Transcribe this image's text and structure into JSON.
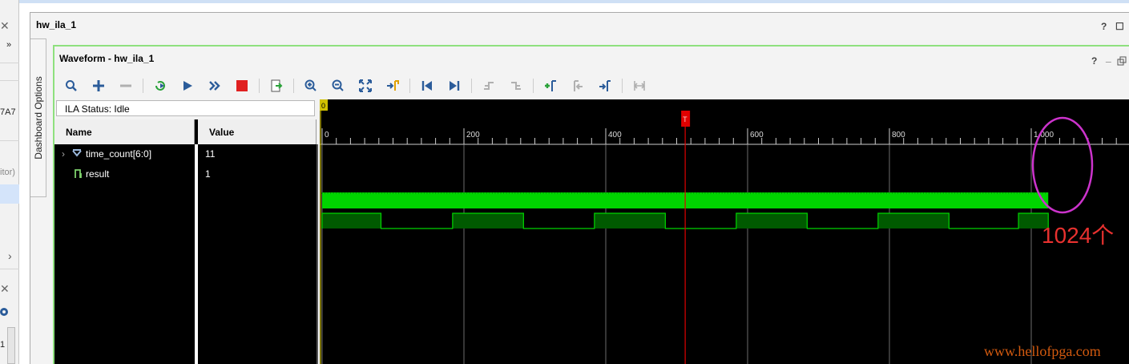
{
  "left_panel": {
    "close_glyph": "✕",
    "chevron": "»",
    "fragment_1": "7A7",
    "fragment_2": "itor)",
    "fragment_3": "1",
    "scroll_right": "›"
  },
  "window": {
    "title": "hw_ila_1",
    "help": "?",
    "restore": "☐"
  },
  "dashboard_tab": {
    "label": "Dashboard Options"
  },
  "waveform_panel": {
    "title": "Waveform - hw_ila_1",
    "help": "?",
    "minimize": "_"
  },
  "toolbar": {
    "icons": [
      "search-icon",
      "add-icon",
      "remove-icon",
      "rerun-icon",
      "run-icon",
      "run-all-icon",
      "stop-icon",
      "export-icon",
      "zoom-in-icon",
      "zoom-out-icon",
      "zoom-fit-icon",
      "go-to-cursor-icon",
      "go-to-start-icon",
      "go-to-end-icon",
      "prev-transition-icon",
      "next-transition-icon",
      "add-marker-icon",
      "prev-marker-icon",
      "next-marker-icon",
      "swap-cursors-icon"
    ]
  },
  "ila": {
    "status": "ILA Status:  Idle"
  },
  "table": {
    "columns": [
      "Name",
      "Value"
    ],
    "rows": [
      {
        "name": "time_count[6:0]",
        "value": "11",
        "icon": "bus-icon",
        "expandable": true
      },
      {
        "name": "result",
        "value": "1",
        "icon": "signal-icon",
        "expandable": false
      }
    ]
  },
  "timeline": {
    "start_marker": "0",
    "trigger_marker": "T",
    "ticks": [
      "0",
      "200",
      "400",
      "600",
      "800",
      "1,000"
    ],
    "sample_count": 1024,
    "trigger_sample": 512
  },
  "annotation": {
    "text": "1024个"
  },
  "watermark": "www.hellofpga.com",
  "colors": {
    "wave_green": "#00d400",
    "trigger_red": "#e00000",
    "panel_border": "#8ee07e",
    "annotation": "#e8312f",
    "watermark": "#d35a0f"
  }
}
